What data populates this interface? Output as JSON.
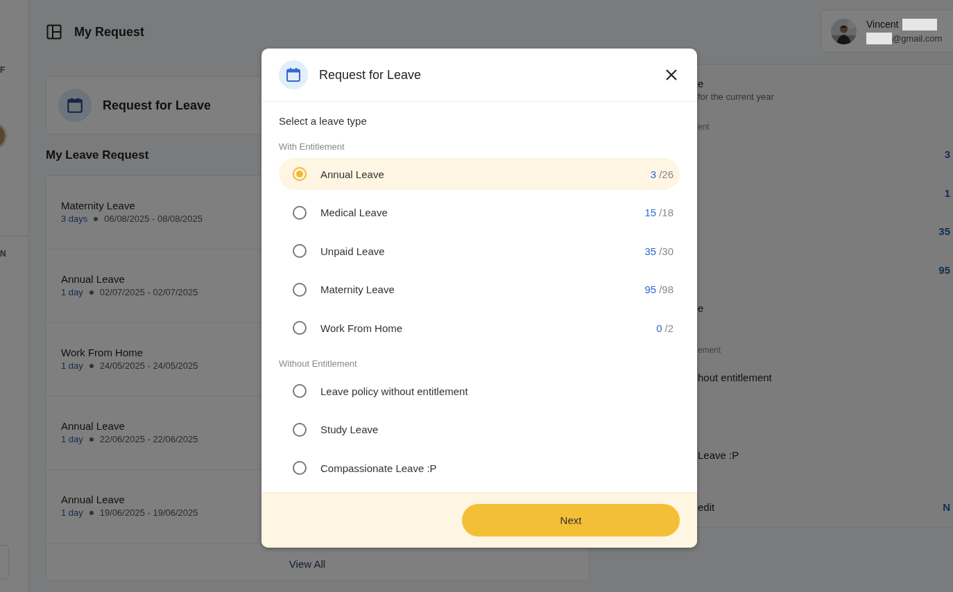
{
  "sidebar": {
    "labels": [
      "F",
      "N"
    ]
  },
  "header": {
    "title": "My Request"
  },
  "user": {
    "name": "Vincent",
    "email": "@gmail.com"
  },
  "request_card": {
    "title": "Request for Leave"
  },
  "leave_requests": {
    "title": "My Leave Request",
    "items": [
      {
        "type": "Maternity Leave",
        "duration": "3 days",
        "dates": "06/08/2025 - 08/08/2025"
      },
      {
        "type": "Annual Leave",
        "duration": "1 day",
        "dates": "02/07/2025 - 02/07/2025"
      },
      {
        "type": "Work From Home",
        "duration": "1 day",
        "dates": "24/05/2025 - 24/05/2025"
      },
      {
        "type": "Annual Leave",
        "duration": "1 day",
        "dates": "22/06/2025 - 22/06/2025"
      },
      {
        "type": "Annual Leave",
        "duration": "1 day",
        "dates": "19/06/2025 - 19/06/2025"
      }
    ],
    "view_all": "View All"
  },
  "summary": {
    "lines": [
      {
        "kind": "heading",
        "text": "e"
      },
      {
        "kind": "subtext",
        "text": "for the current year"
      },
      {
        "kind": "group",
        "text": "ent"
      },
      {
        "kind": "row",
        "value": "3"
      },
      {
        "kind": "row",
        "value": "1"
      },
      {
        "kind": "row",
        "value": "35"
      },
      {
        "kind": "row",
        "value": "95"
      },
      {
        "kind": "row",
        "label": "e"
      },
      {
        "kind": "group",
        "text": "ement"
      },
      {
        "kind": "row",
        "label": "hout entitlement"
      },
      {
        "kind": "row-far",
        "label": "Leave :P"
      },
      {
        "kind": "total",
        "label": "edit",
        "value": "N"
      }
    ]
  },
  "modal": {
    "title": "Request for Leave",
    "prompt": "Select a leave type",
    "groups": [
      {
        "label": "With Entitlement",
        "options": [
          {
            "label": "Annual Leave",
            "used": "3",
            "total": "/26",
            "selected": true
          },
          {
            "label": "Medical Leave",
            "used": "15",
            "total": "/18",
            "selected": false
          },
          {
            "label": "Unpaid Leave",
            "used": "35",
            "total": "/30",
            "selected": false
          },
          {
            "label": "Maternity Leave",
            "used": "95",
            "total": "/98",
            "selected": false
          },
          {
            "label": "Work From Home",
            "used": "0",
            "total": "/2",
            "selected": false
          }
        ]
      },
      {
        "label": "Without Entitlement",
        "options": [
          {
            "label": "Leave policy without entitlement",
            "selected": false
          },
          {
            "label": "Study Leave",
            "selected": false
          },
          {
            "label": "Compassionate Leave :P",
            "selected": false
          }
        ]
      }
    ],
    "button": "Next"
  }
}
